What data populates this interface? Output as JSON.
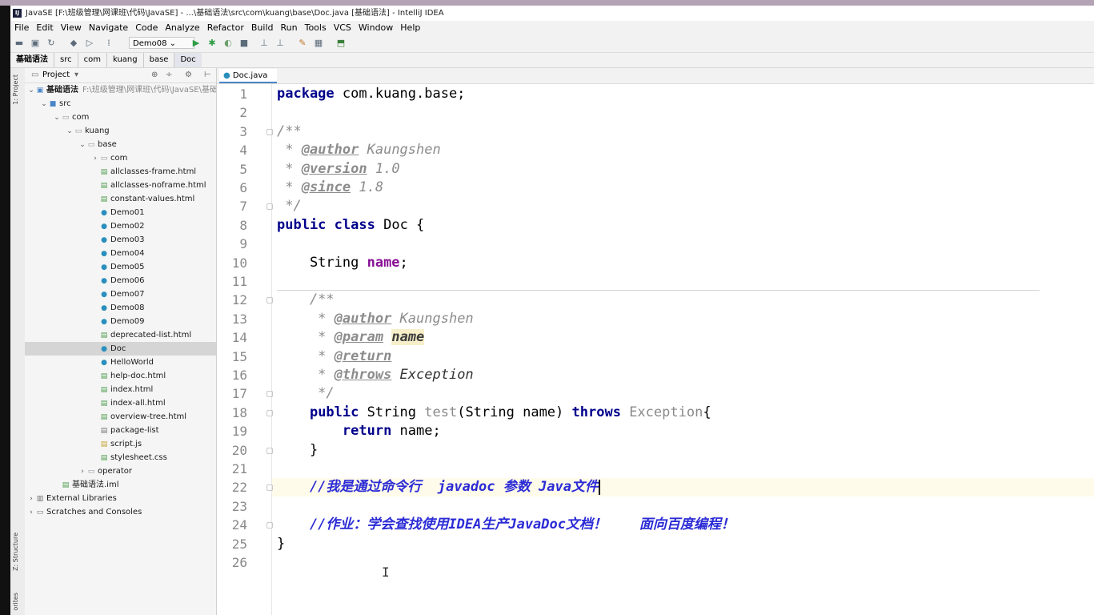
{
  "window": {
    "title": "JavaSE [F:\\班级管理\\网课班\\代码\\JavaSE] - ...\\基础语法\\src\\com\\kuang\\base\\Doc.java [基础语法] - IntelliJ IDEA",
    "app_icon": "IJ"
  },
  "menu": [
    "File",
    "Edit",
    "View",
    "Navigate",
    "Code",
    "Analyze",
    "Refactor",
    "Build",
    "Run",
    "Tools",
    "VCS",
    "Window",
    "Help"
  ],
  "toolbar": {
    "run_config": "Demo08"
  },
  "breadcrumbs": [
    "基础语法",
    "src",
    "com",
    "kuang",
    "base",
    "Doc"
  ],
  "side_tabs": {
    "project": "1: Project",
    "structure": "Z: Structure",
    "favorites": "orites"
  },
  "project_panel": {
    "title": "Project",
    "tree": [
      {
        "label": "基础语法",
        "suffix": "F:\\班级管理\\网课班\\代码\\JavaSE\\基础",
        "icon": "module-folder",
        "depth": 0,
        "arrow": "⌄"
      },
      {
        "label": "src",
        "icon": "source-folder",
        "depth": 1,
        "arrow": "⌄"
      },
      {
        "label": "com",
        "icon": "package-folder",
        "depth": 2,
        "arrow": "⌄"
      },
      {
        "label": "kuang",
        "icon": "package-folder",
        "depth": 3,
        "arrow": "⌄"
      },
      {
        "label": "base",
        "icon": "package-folder",
        "depth": 4,
        "arrow": "⌄"
      },
      {
        "label": "com",
        "icon": "package-folder",
        "depth": 5,
        "arrow": "›"
      },
      {
        "label": "allclasses-frame.html",
        "icon": "html-file",
        "depth": 5
      },
      {
        "label": "allclasses-noframe.html",
        "icon": "html-file",
        "depth": 5
      },
      {
        "label": "constant-values.html",
        "icon": "html-file",
        "depth": 5
      },
      {
        "label": "Demo01",
        "icon": "class",
        "depth": 5
      },
      {
        "label": "Demo02",
        "icon": "class",
        "depth": 5
      },
      {
        "label": "Demo03",
        "icon": "class",
        "depth": 5
      },
      {
        "label": "Demo04",
        "icon": "class",
        "depth": 5
      },
      {
        "label": "Demo05",
        "icon": "class",
        "depth": 5
      },
      {
        "label": "Demo06",
        "icon": "class",
        "depth": 5
      },
      {
        "label": "Demo07",
        "icon": "class",
        "depth": 5
      },
      {
        "label": "Demo08",
        "icon": "class",
        "depth": 5
      },
      {
        "label": "Demo09",
        "icon": "class",
        "depth": 5
      },
      {
        "label": "deprecated-list.html",
        "icon": "html-file",
        "depth": 5
      },
      {
        "label": "Doc",
        "icon": "class",
        "depth": 5,
        "selected": true
      },
      {
        "label": "HelloWorld",
        "icon": "class",
        "depth": 5
      },
      {
        "label": "help-doc.html",
        "icon": "html-file",
        "depth": 5
      },
      {
        "label": "index.html",
        "icon": "html-file",
        "depth": 5
      },
      {
        "label": "index-all.html",
        "icon": "html-file",
        "depth": 5
      },
      {
        "label": "overview-tree.html",
        "icon": "html-file",
        "depth": 5
      },
      {
        "label": "package-list",
        "icon": "text-file",
        "depth": 5
      },
      {
        "label": "script.js",
        "icon": "js-file",
        "depth": 5
      },
      {
        "label": "stylesheet.css",
        "icon": "css-file",
        "depth": 5
      },
      {
        "label": "operator",
        "icon": "package-folder",
        "depth": 4,
        "arrow": "›"
      },
      {
        "label": "基础语法.iml",
        "icon": "iml-file",
        "depth": 2
      },
      {
        "label": "External Libraries",
        "icon": "library",
        "depth": 0,
        "arrow": "›"
      },
      {
        "label": "Scratches and Consoles",
        "icon": "scratches",
        "depth": 0,
        "arrow": "›"
      }
    ]
  },
  "editor": {
    "tab_label": "Doc.java",
    "current_line": 22,
    "lines": [
      [
        {
          "t": "package",
          "c": "kw"
        },
        {
          "t": " com.kuang.base;"
        }
      ],
      [],
      [
        {
          "t": "/**",
          "c": "cm"
        }
      ],
      [
        {
          "t": " * ",
          "c": "cm"
        },
        {
          "t": "@author",
          "c": "tag"
        },
        {
          "t": " Kaungshen",
          "c": "cm"
        }
      ],
      [
        {
          "t": " * ",
          "c": "cm"
        },
        {
          "t": "@version",
          "c": "tag"
        },
        {
          "t": " 1.0",
          "c": "cm"
        }
      ],
      [
        {
          "t": " * ",
          "c": "cm"
        },
        {
          "t": "@since",
          "c": "tag"
        },
        {
          "t": " 1.8",
          "c": "cm"
        }
      ],
      [
        {
          "t": " */",
          "c": "cm"
        }
      ],
      [
        {
          "t": "public",
          "c": "kw"
        },
        {
          "t": " "
        },
        {
          "t": "class",
          "c": "kw"
        },
        {
          "t": " Doc {"
        }
      ],
      [],
      [
        {
          "t": "    String "
        },
        {
          "t": "name",
          "c": "fld"
        },
        {
          "t": ";"
        }
      ],
      [],
      [
        {
          "t": "    /**",
          "c": "cm"
        }
      ],
      [
        {
          "t": "     * ",
          "c": "cm"
        },
        {
          "t": "@author",
          "c": "tag"
        },
        {
          "t": " Kaungshen",
          "c": "cm"
        }
      ],
      [
        {
          "t": "     * ",
          "c": "cm"
        },
        {
          "t": "@param",
          "c": "tag"
        },
        {
          "t": " "
        },
        {
          "t": "name",
          "c": "pname"
        }
      ],
      [
        {
          "t": "     * ",
          "c": "cm"
        },
        {
          "t": "@return",
          "c": "tag"
        }
      ],
      [
        {
          "t": "     * ",
          "c": "cm"
        },
        {
          "t": "@throws",
          "c": "tag"
        },
        {
          "t": " Exception",
          "c": "cm-dark"
        }
      ],
      [
        {
          "t": "     */",
          "c": "cm"
        }
      ],
      [
        {
          "t": "    "
        },
        {
          "t": "public",
          "c": "kw"
        },
        {
          "t": " String "
        },
        {
          "t": "test",
          "c": "uncol"
        },
        {
          "t": "(String name) "
        },
        {
          "t": "throws",
          "c": "kw"
        },
        {
          "t": " "
        },
        {
          "t": "Exception",
          "c": "uncol"
        },
        {
          "t": "{"
        }
      ],
      [
        {
          "t": "        "
        },
        {
          "t": "return",
          "c": "kw"
        },
        {
          "t": " name;"
        }
      ],
      [
        {
          "t": "    }"
        }
      ],
      [],
      [
        {
          "t": "    //我是通过命令行  javadoc 参数 Java文件",
          "c": "lc"
        }
      ],
      [],
      [
        {
          "t": "    //作业：学会查找使用IDEA生产JavaDoc文档！    面向百度编程！",
          "c": "lc"
        }
      ],
      [
        {
          "t": "}"
        }
      ],
      []
    ]
  }
}
